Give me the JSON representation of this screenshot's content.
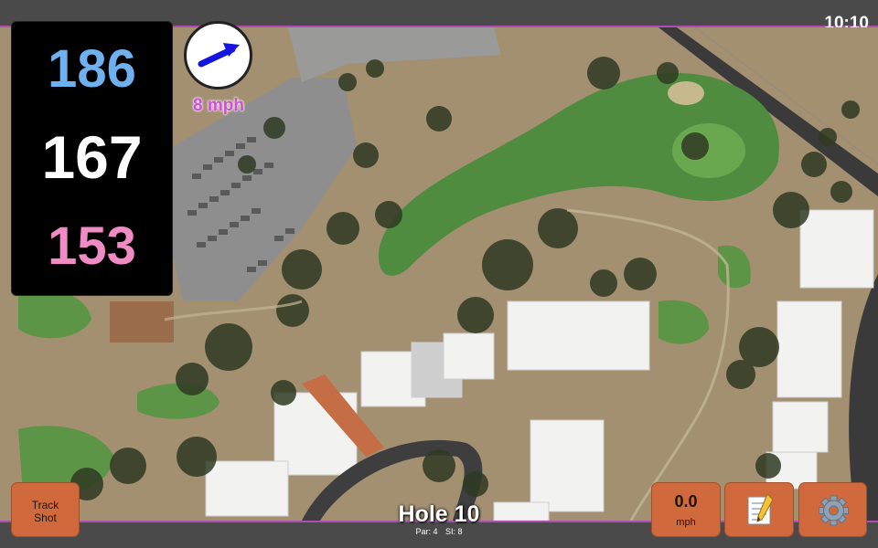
{
  "status": {
    "time": "10:10"
  },
  "yardages": {
    "back": "186",
    "middle": "167",
    "front": "153"
  },
  "wind": {
    "speed": "8 mph",
    "direction_icon": "arrow-northeast-icon"
  },
  "buttons": {
    "track_shot": "Track\nShot",
    "speed_value": "0.0",
    "speed_unit": "mph",
    "notes_icon": "memo-icon",
    "settings_icon": "gear-icon"
  },
  "hole": {
    "title": "Hole 10",
    "par": "Par: 4",
    "si": "SI: 8"
  },
  "colors": {
    "accent": "#b04cb4",
    "button": "#d06a3c",
    "back_yardage": "#6fb0ee",
    "middle_yardage": "#ffffff",
    "front_yardage": "#f08cc4",
    "wind_text": "#d050d8"
  }
}
